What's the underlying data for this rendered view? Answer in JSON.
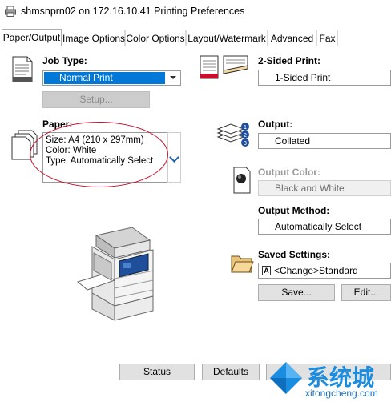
{
  "window": {
    "title": "shmsnprn02 on 172.16.10.41 Printing Preferences"
  },
  "tabs": [
    {
      "label": "Paper/Output",
      "active": true
    },
    {
      "label": "Image Options"
    },
    {
      "label": "Color Options"
    },
    {
      "label": "Layout/Watermark"
    },
    {
      "label": "Advanced"
    },
    {
      "label": "Fax"
    }
  ],
  "job_type": {
    "label": "Job Type:",
    "value": "Normal Print",
    "setup_button": "Setup..."
  },
  "paper": {
    "label": "Paper:",
    "lines": [
      "Size: A4 (210 x 297mm)",
      "Color: White",
      "Type: Automatically Select"
    ]
  },
  "two_sided": {
    "label": "2-Sided Print:",
    "value": "1-Sided Print"
  },
  "output": {
    "label": "Output:",
    "value": "Collated"
  },
  "output_color": {
    "label": "Output Color:",
    "value": "Black and White"
  },
  "output_method": {
    "label": "Output Method:",
    "value": "Automatically Select"
  },
  "saved_settings": {
    "label": "Saved Settings:",
    "value": "<Change>Standard",
    "icon_letter": "A",
    "save_button": "Save...",
    "edit_button": "Edit..."
  },
  "bottom": {
    "status_button": "Status",
    "defaults_button": "Defaults"
  },
  "watermark": {
    "text": "系统城",
    "url": "xitongcheng.com"
  },
  "colors": {
    "highlight": "#0078d7",
    "annotation": "#c8102e"
  }
}
